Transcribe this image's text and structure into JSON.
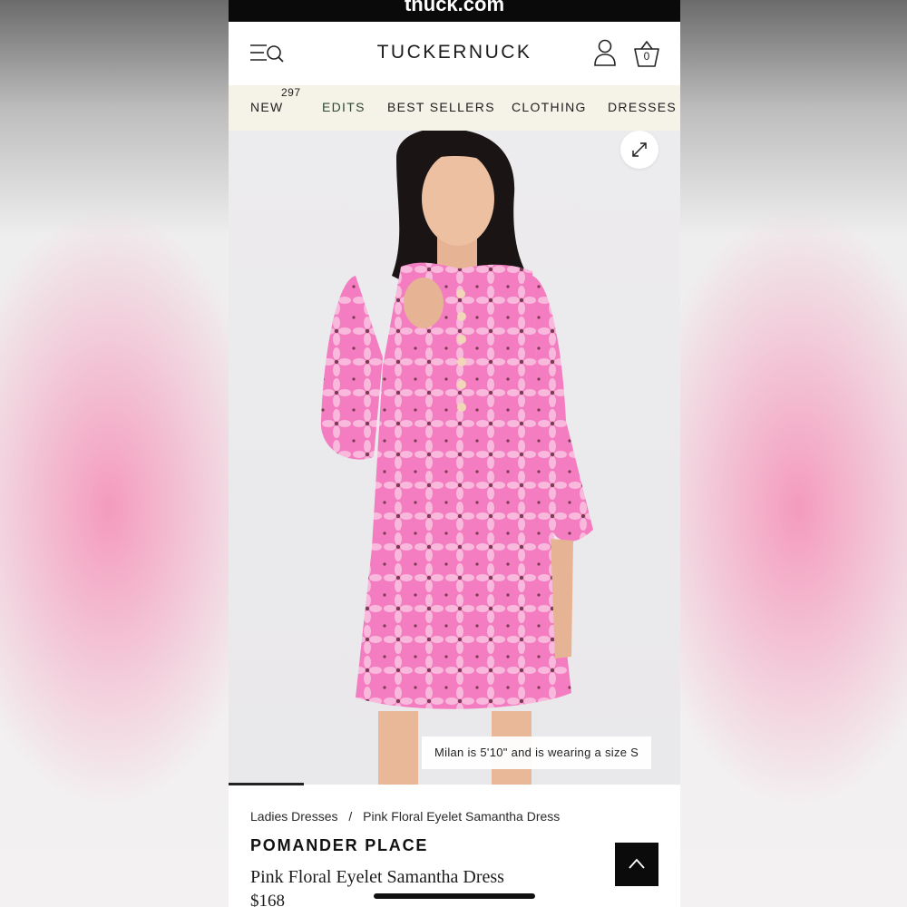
{
  "browser": {
    "url_text": "tnuck.com"
  },
  "header": {
    "brand": "TUCKERNUCK",
    "menu_icon": "menu-search-icon",
    "account_icon": "account-icon",
    "bag_icon": "shopping-bag-icon",
    "bag_count": "0"
  },
  "nav": {
    "items": [
      {
        "label": "NEW",
        "badge": "297"
      },
      {
        "label": "EDITS"
      },
      {
        "label": "BEST SELLERS"
      },
      {
        "label": "CLOTHING"
      },
      {
        "label": "DRESSES"
      }
    ]
  },
  "hero": {
    "expand_icon": "expand-icon",
    "caption": "Milan is 5'10\" and is wearing a size S",
    "colors": {
      "dress": "#f27fbf",
      "background": "#ebeaec"
    }
  },
  "product": {
    "breadcrumb": [
      "Ladies Dresses",
      "Pink Floral Eyelet Samantha Dress"
    ],
    "breadcrumb_sep": "/",
    "brand": "POMANDER PLACE",
    "name": "Pink Floral Eyelet Samantha Dress",
    "price": "$168"
  },
  "controls": {
    "back_to_top_icon": "chevron-up-icon"
  }
}
